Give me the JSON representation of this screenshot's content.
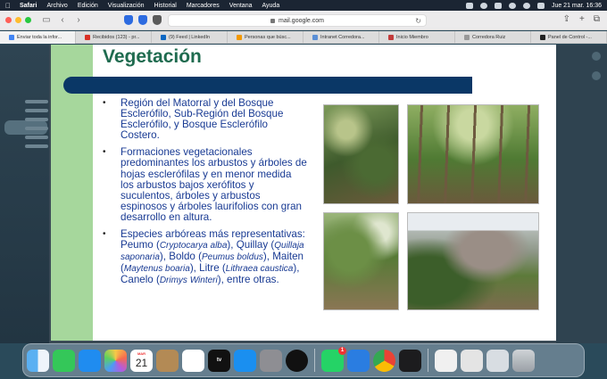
{
  "menubar": {
    "apple": "",
    "items": [
      "Safari",
      "Archivo",
      "Edición",
      "Visualización",
      "Historial",
      "Marcadores",
      "Ventana",
      "Ayuda"
    ],
    "clock": "Jue 21 mar.  16:36"
  },
  "toolbar": {
    "url": "mail.google.com",
    "reload_icon": "↻"
  },
  "tabs": [
    {
      "label": "Enviar toda la infor...",
      "color": "#4285f4"
    },
    {
      "label": "Recibidos (123) - pr...",
      "color": "#d93025"
    },
    {
      "label": "(9) Feed | LinkedIn",
      "color": "#0a66c2"
    },
    {
      "label": "Personas que búsc...",
      "color": "#f29900"
    },
    {
      "label": "Intranet Corredora...",
      "color": "#5a8fd6"
    },
    {
      "label": "Inicio Miembro",
      "color": "#c23b3b"
    },
    {
      "label": "Corredora Ruiz",
      "color": "#999999"
    },
    {
      "label": "Panel de Control -...",
      "color": "#222222"
    }
  ],
  "slide": {
    "title": "Vegetación",
    "bullets": [
      {
        "text": "Región del Matorral y del Bosque Esclerófilo, Sub-Región del Bosque Esclerófilo, y Bosque Esclerófilo Costero."
      },
      {
        "text": "Formaciones vegetacionales predominantes los arbustos y árboles de hojas esclerófilas y en menor medida los arbustos bajos xerófitos y suculentos, árboles y arbustos espinosos y árboles laurifolios con gran desarrollo en altura."
      },
      {
        "segments": [
          {
            "t": "Especies arbóreas más representativas: Peumo (",
            "i": false
          },
          {
            "t": "Cryptocarya alba",
            "i": true
          },
          {
            "t": "), Quillay (",
            "i": false
          },
          {
            "t": "Quillaja saponaria",
            "i": true
          },
          {
            "t": "), Boldo (",
            "i": false
          },
          {
            "t": "Peumus boldus",
            "i": true
          },
          {
            "t": "), Maiten (",
            "i": false
          },
          {
            "t": "Maytenus boaria",
            "i": true
          },
          {
            "t": "), Litre (",
            "i": false
          },
          {
            "t": "Lithraea caustica",
            "i": true
          },
          {
            "t": "), Canelo (",
            "i": false
          },
          {
            "t": "Drimys Winteri",
            "i": true
          },
          {
            "t": "), entre otras.",
            "i": false
          }
        ]
      }
    ]
  },
  "dock": {
    "calendar_month": "MAR",
    "calendar_day": "21",
    "appletv_label": "tv",
    "whatsapp_badge": "1",
    "apps": [
      "finder-icon",
      "messages-icon",
      "mail-icon",
      "photos-icon",
      "calendar-icon",
      "contacts-icon",
      "reminders-icon",
      "appletv-icon",
      "appstore-icon",
      "system-settings-icon",
      "spotify-icon",
      "whatsapp-icon",
      "safari-icon",
      "chrome-icon",
      "audio-app-icon"
    ]
  }
}
